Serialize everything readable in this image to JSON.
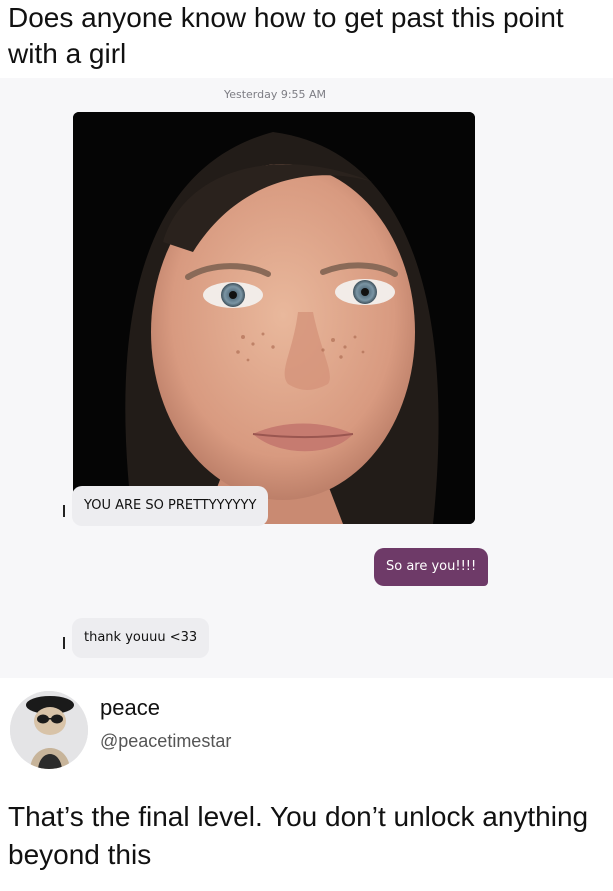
{
  "post": {
    "title": "Does anyone know how to get past this point with a girl"
  },
  "conversation": {
    "timestamp": "Yesterday 9:55 AM",
    "messages": [
      {
        "side": "received",
        "text": "YOU ARE SO PRETTYYYYYY"
      },
      {
        "side": "sent",
        "text": "So are you!!!!"
      },
      {
        "side": "received",
        "text": "thank youuu <33"
      }
    ],
    "sent_bubble_color": "#6e3a68",
    "received_bubble_color": "#ededf0"
  },
  "reply": {
    "display_name": "peace",
    "handle": "@peacetimestar",
    "avatar": "cat-avatar-icon",
    "text": "That’s the final level. You don’t unlock anything beyond this"
  }
}
